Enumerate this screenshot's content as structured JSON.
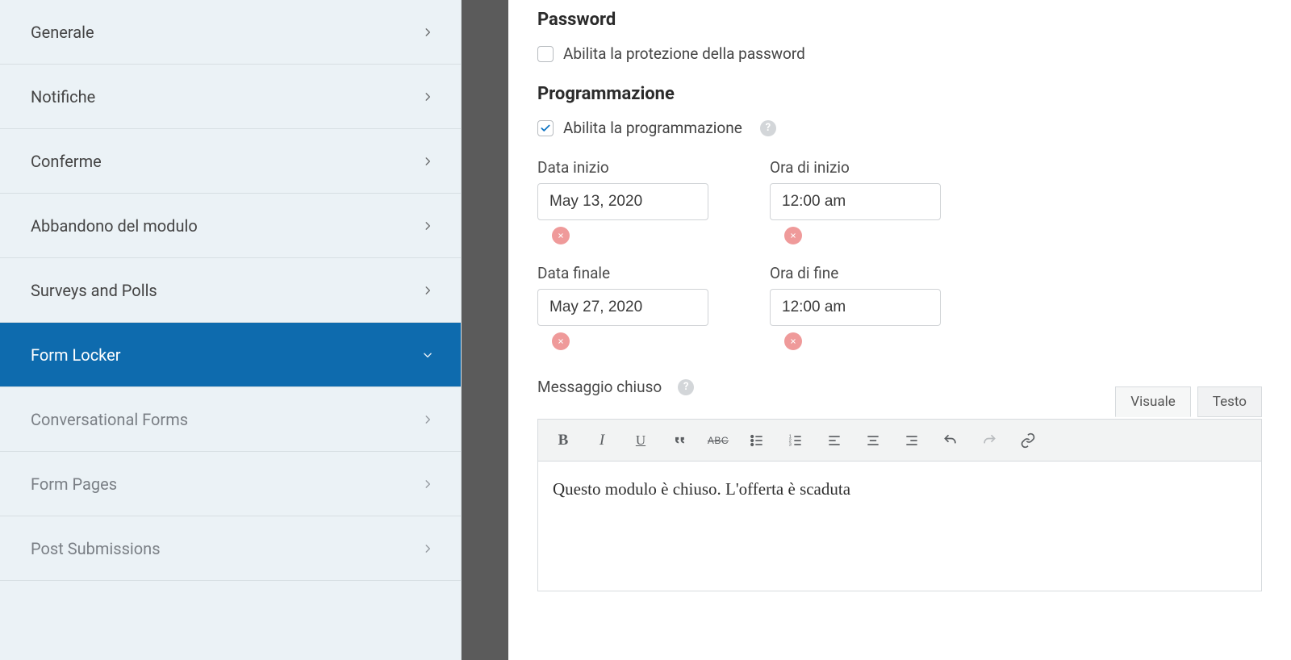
{
  "sidebar": {
    "items": [
      {
        "label": "Generale",
        "active": false,
        "sub": false,
        "arrow": "right"
      },
      {
        "label": "Notifiche",
        "active": false,
        "sub": false,
        "arrow": "right"
      },
      {
        "label": "Conferme",
        "active": false,
        "sub": false,
        "arrow": "right"
      },
      {
        "label": "Abbandono del modulo",
        "active": false,
        "sub": false,
        "arrow": "right"
      },
      {
        "label": "Surveys and Polls",
        "active": false,
        "sub": false,
        "arrow": "right"
      },
      {
        "label": "Form Locker",
        "active": true,
        "sub": false,
        "arrow": "down"
      },
      {
        "label": "Conversational Forms",
        "active": false,
        "sub": true,
        "arrow": "right"
      },
      {
        "label": "Form Pages",
        "active": false,
        "sub": true,
        "arrow": "right"
      },
      {
        "label": "Post Submissions",
        "active": false,
        "sub": true,
        "arrow": "right"
      }
    ]
  },
  "password": {
    "heading": "Password",
    "enable_label": "Abilita la protezione della password",
    "enabled": false
  },
  "scheduling": {
    "heading": "Programmazione",
    "enable_label": "Abilita la programmazione",
    "enabled": true,
    "fields": {
      "start_date_label": "Data inizio",
      "start_time_label": "Ora di inizio",
      "end_date_label": "Data finale",
      "end_time_label": "Ora di fine",
      "start_date": "May 13, 2020",
      "start_time": "12:00 am",
      "end_date": "May 27, 2020",
      "end_time": "12:00 am"
    },
    "closed_message_label": "Messaggio chiuso"
  },
  "editor": {
    "tabs": {
      "visual": "Visuale",
      "text": "Testo",
      "active": "visual"
    },
    "toolbar": {
      "bold": "B",
      "italic": "I",
      "underline": "U",
      "strike_label": "ABC"
    },
    "content": "Questo modulo è chiuso. L'offerta è scaduta"
  }
}
